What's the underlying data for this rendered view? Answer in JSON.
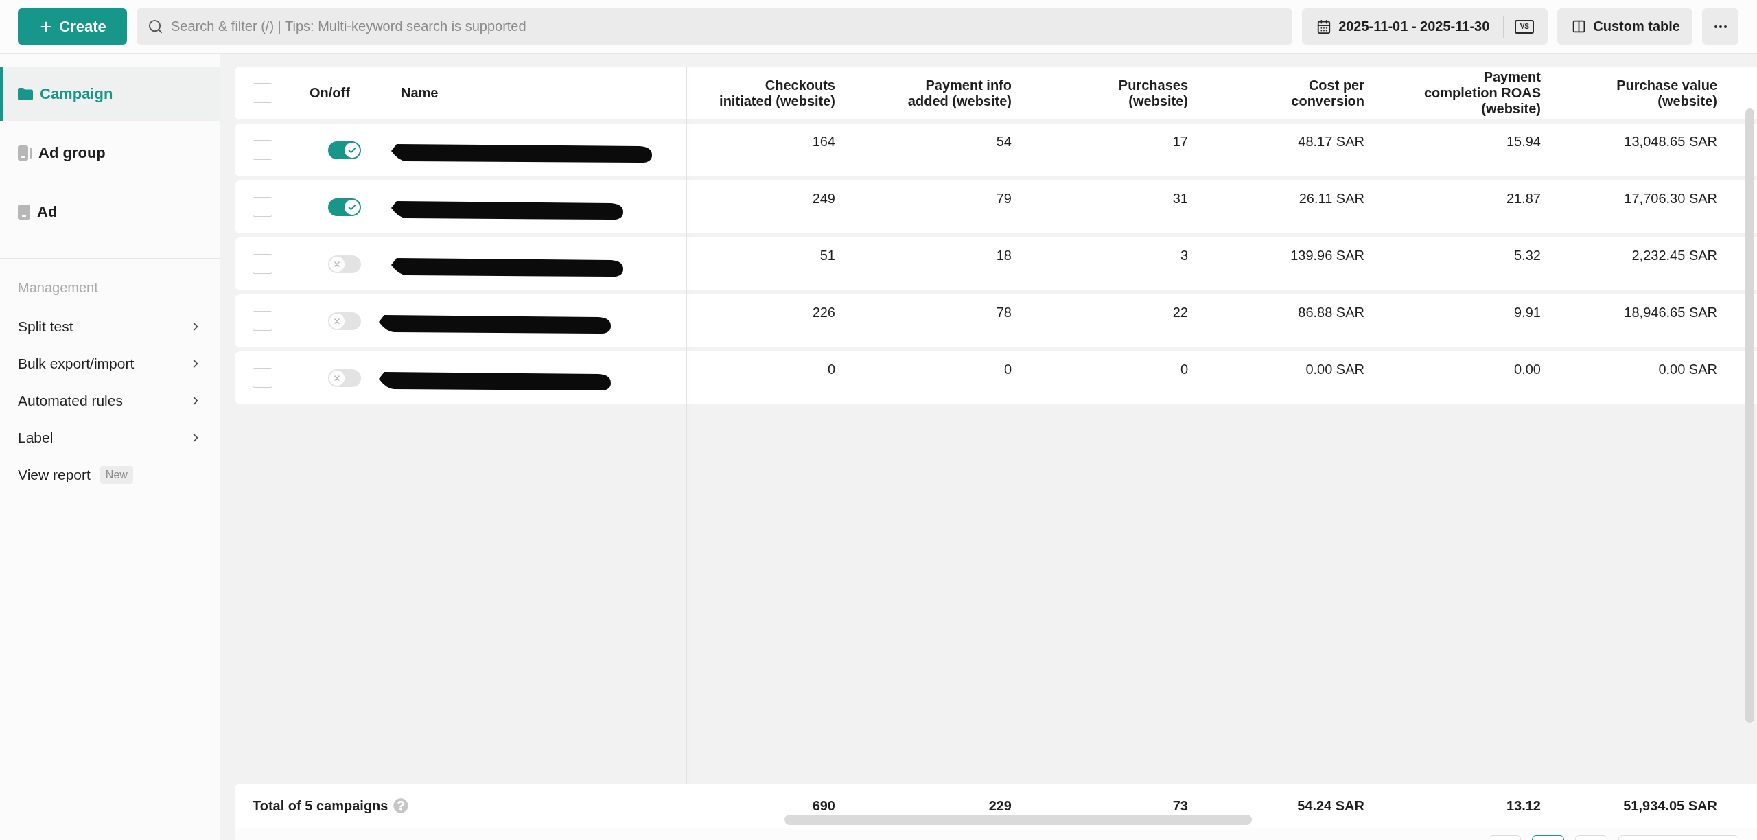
{
  "toolbar": {
    "create_button": "Create",
    "search": {
      "placeholder": "Search & filter (/) | Tips: Multi-keyword search is supported"
    },
    "date_range": "2025-11-01 - 2025-11-30",
    "compare_button": "VS",
    "custom_table_button": "Custom table"
  },
  "sidebar": {
    "levels": [
      {
        "label": "Campaign",
        "kind": "folder",
        "selected": true
      },
      {
        "label": "Ad group",
        "kind": "stack",
        "selected": false
      },
      {
        "label": "Ad",
        "kind": "card",
        "selected": false
      }
    ],
    "management": {
      "heading": "Management",
      "items": [
        {
          "label": "Split test",
          "kind": "submenu"
        },
        {
          "label": "Bulk export/import",
          "kind": "submenu"
        },
        {
          "label": "Automated rules",
          "kind": "submenu"
        },
        {
          "label": "Label",
          "kind": "submenu"
        },
        {
          "label": "View report",
          "kind": "badge",
          "badge": "New"
        }
      ]
    }
  },
  "table": {
    "select_all": {
      "checked": false
    },
    "columns": [
      "On/off",
      "Name",
      "Checkouts\ninitiated (website)",
      "Payment info\nadded (website)",
      "Purchases\n(website)",
      "Cost per\nconversion",
      "Payment\ncompletion ROAS\n(website)",
      "Purchase value\n(website)"
    ],
    "rows": [
      {
        "checked": false,
        "on": true,
        "values": [
          "164",
          "54",
          "17",
          "48.17 SAR",
          "15.94",
          "13,048.65 SAR"
        ]
      },
      {
        "checked": false,
        "on": true,
        "values": [
          "249",
          "79",
          "31",
          "26.11 SAR",
          "21.87",
          "17,706.30 SAR"
        ]
      },
      {
        "checked": false,
        "on": false,
        "values": [
          "51",
          "18",
          "3",
          "139.96 SAR",
          "5.32",
          "2,232.45 SAR"
        ]
      },
      {
        "checked": false,
        "on": false,
        "values": [
          "226",
          "78",
          "22",
          "86.88 SAR",
          "9.91",
          "18,946.65 SAR"
        ]
      },
      {
        "checked": false,
        "on": false,
        "values": [
          "0",
          "0",
          "0",
          "0.00 SAR",
          "0.00",
          "0.00 SAR"
        ]
      }
    ],
    "total": {
      "label": "Total of 5 campaigns",
      "values": [
        "690",
        "229",
        "73",
        "54.24 SAR",
        "13.12",
        "51,934.05 SAR"
      ]
    }
  },
  "pagination": {
    "buttons": [
      {
        "selected": false
      },
      {
        "selected": true
      },
      {
        "selected": false
      }
    ]
  }
}
